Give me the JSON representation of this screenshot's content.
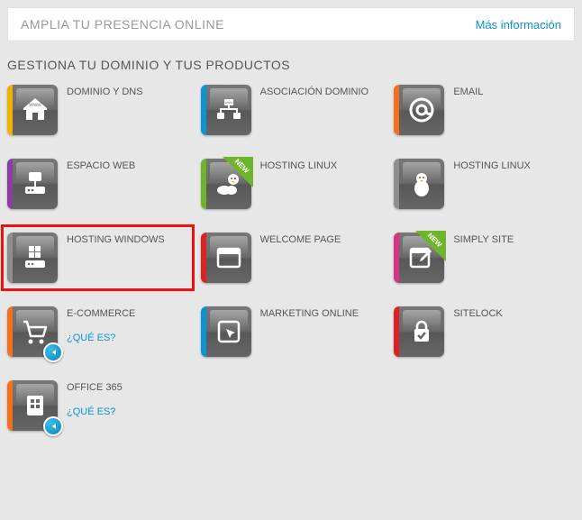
{
  "banner": {
    "title": "AMPLIA TU PRESENCIA ONLINE",
    "more": "Más información"
  },
  "section_title": "GESTIONA TU DOMINIO Y TUS PRODUCTOS",
  "sublink_text": "¿QUÉ ES?",
  "badge_new_text": "NEW",
  "colors": {
    "yellow": "#f2b100",
    "blue": "#0a94d6",
    "orange": "#f37021",
    "purple": "#8a3fa0",
    "green": "#6fb52c",
    "grey": "#8e8e8e",
    "red": "#d22",
    "magenta": "#d63384"
  },
  "items": [
    {
      "label": "DOMINIO Y DNS",
      "icon": "house",
      "accent": "yellow"
    },
    {
      "label": "ASOCIACIÓN DOMINIO",
      "icon": "network",
      "accent": "blue"
    },
    {
      "label": "EMAIL",
      "icon": "at",
      "accent": "orange"
    },
    {
      "label": "ESPACIO WEB",
      "icon": "webspace",
      "accent": "purple"
    },
    {
      "label": "HOSTING LINUX",
      "icon": "penguin-cloud",
      "accent": "green",
      "new": true
    },
    {
      "label": "HOSTING LINUX",
      "icon": "penguin",
      "accent": "grey"
    },
    {
      "label": "HOSTING WINDOWS",
      "icon": "windows-server",
      "accent": "grey",
      "highlight": true
    },
    {
      "label": "WELCOME PAGE",
      "icon": "browser",
      "accent": "red"
    },
    {
      "label": "SIMPLY SITE",
      "icon": "edit-page",
      "accent": "magenta",
      "new": true
    },
    {
      "label": "E-COMMERCE",
      "icon": "cart",
      "accent": "orange",
      "info": true,
      "sublink": true
    },
    {
      "label": "MARKETING ONLINE",
      "icon": "cursor-frame",
      "accent": "blue"
    },
    {
      "label": "SITELOCK",
      "icon": "lock-check",
      "accent": "red"
    },
    {
      "label": "OFFICE 365",
      "icon": "office",
      "accent": "orange",
      "info": true,
      "sublink": true
    }
  ]
}
